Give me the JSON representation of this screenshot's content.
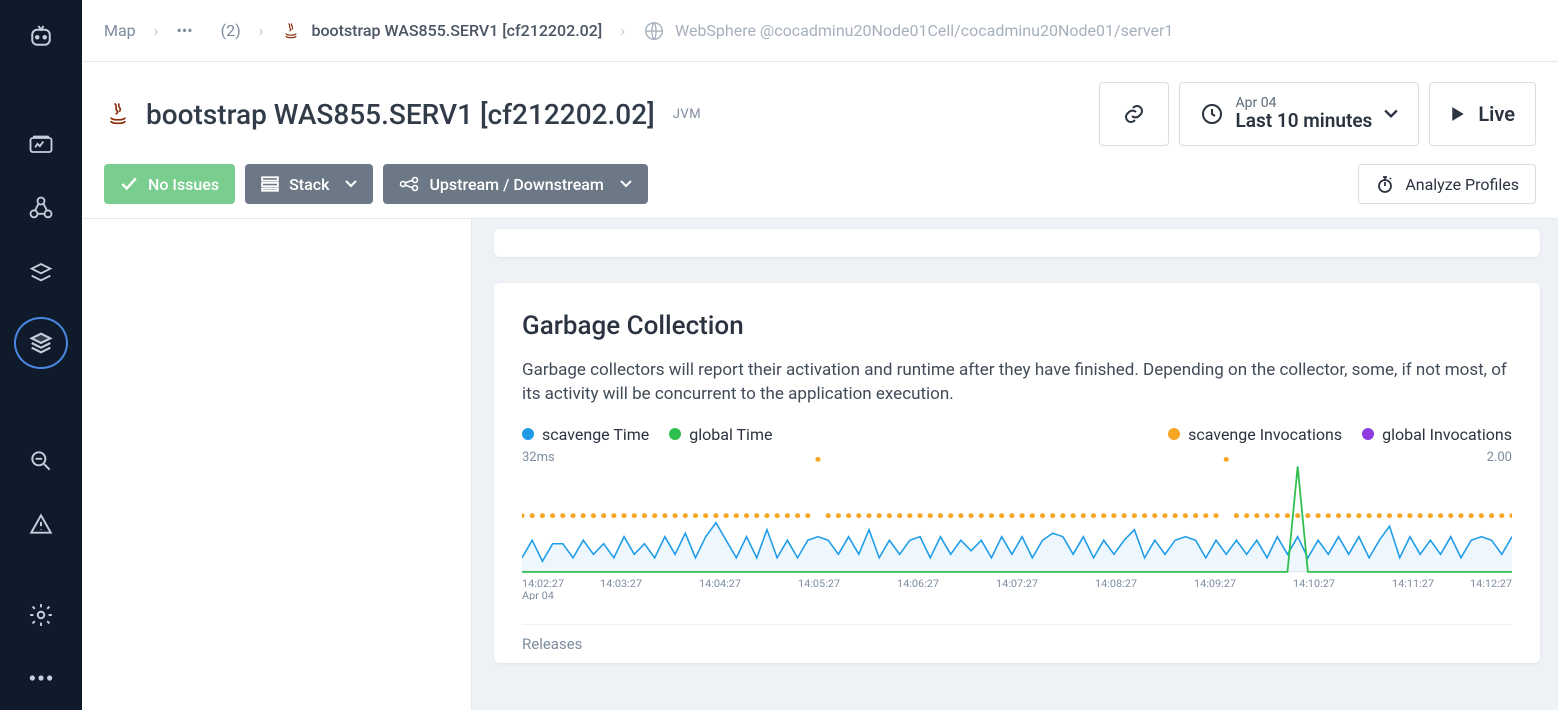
{
  "breadcrumb": {
    "map": "Map",
    "count_label": "(2)",
    "item": "bootstrap WAS855.SERV1 [cf212202.02]",
    "server": "WebSphere @cocadminu20Node01Cell/cocadminu20Node01/server1"
  },
  "page": {
    "title": "bootstrap WAS855.SERV1 [cf212202.02]",
    "tag": "JVM"
  },
  "timeframe": {
    "date": "Apr 04",
    "range": "Last 10 minutes",
    "live": "Live"
  },
  "status": {
    "no_issues": "No Issues"
  },
  "toolbar": {
    "stack": "Stack",
    "updown": "Upstream / Downstream",
    "analyze": "Analyze Profiles"
  },
  "gc": {
    "title": "Garbage Collection",
    "desc": "Garbage collectors will report their activation and runtime after they have finished. Depending on the collector, some, if not most, of its activity will be concurrent to the application execution.",
    "legend": {
      "l1": "scavenge Time",
      "l2": "global Time",
      "r1": "scavenge Invocations",
      "r2": "global Invocations"
    },
    "y_left": "32ms",
    "y_right": "2.00",
    "releases": "Releases",
    "x_date": "Apr 04"
  },
  "colors": {
    "blue": "#1f9ce8",
    "green": "#2fbf4e",
    "orange": "#f5a623",
    "purple": "#8e3ce0"
  },
  "chart_data": {
    "type": "line",
    "title": "Garbage Collection",
    "xlabel": "Apr 04",
    "y_left_lim": [
      0,
      32
    ],
    "y_right_lim": [
      0,
      2
    ],
    "x_ticks": [
      "14:02:27",
      "14:03:27",
      "14:04:27",
      "14:05:27",
      "14:06:27",
      "14:07:27",
      "14:08:27",
      "14:09:27",
      "14:10:27",
      "14:11:27",
      "14:12:27"
    ],
    "series": [
      {
        "name": "scavenge Time",
        "axis": "left",
        "color": "#1f9ce8",
        "values_ms": [
          4,
          9,
          3,
          8,
          8,
          4,
          9,
          5,
          8,
          4,
          10,
          5,
          8,
          4,
          10,
          5,
          11,
          4,
          10,
          14,
          9,
          4,
          10,
          4,
          12,
          4,
          9,
          4,
          9,
          10,
          9,
          5,
          10,
          5,
          12,
          4,
          9,
          5,
          9,
          10,
          4,
          10,
          5,
          9,
          6,
          9,
          4,
          10,
          5,
          10,
          4,
          9,
          11,
          10,
          5,
          10,
          4,
          9,
          5,
          9,
          12,
          4,
          9,
          5,
          9,
          10,
          9,
          4,
          9,
          5,
          9,
          5,
          9,
          4,
          10,
          5,
          10,
          4,
          9,
          5,
          10,
          5,
          10,
          4,
          9,
          13,
          4,
          10,
          5,
          9,
          5,
          10,
          4,
          9,
          10,
          9,
          5,
          10
        ]
      },
      {
        "name": "global Time",
        "axis": "left",
        "color": "#2fbf4e",
        "values_ms": [
          0,
          0,
          0,
          0,
          0,
          0,
          0,
          0,
          0,
          0,
          0,
          0,
          0,
          0,
          0,
          0,
          0,
          0,
          0,
          0,
          0,
          0,
          0,
          0,
          0,
          0,
          0,
          0,
          0,
          0,
          0,
          0,
          0,
          0,
          0,
          0,
          0,
          0,
          0,
          0,
          0,
          0,
          0,
          0,
          0,
          0,
          0,
          0,
          0,
          0,
          0,
          0,
          0,
          0,
          0,
          0,
          0,
          0,
          0,
          0,
          0,
          0,
          0,
          0,
          0,
          0,
          0,
          0,
          0,
          0,
          0,
          0,
          0,
          0,
          0,
          0,
          30,
          0,
          0,
          0,
          0,
          0,
          0,
          0,
          0,
          0,
          0,
          0,
          0,
          0,
          0,
          0,
          0,
          0,
          0,
          0,
          0,
          0
        ]
      },
      {
        "name": "scavenge Invocations",
        "axis": "right",
        "color": "#f5a623",
        "values": [
          1,
          1,
          1,
          1,
          1,
          1,
          1,
          1,
          1,
          1,
          1,
          1,
          1,
          1,
          1,
          1,
          1,
          1,
          1,
          1,
          1,
          1,
          1,
          1,
          1,
          1,
          1,
          1,
          1,
          2,
          1,
          1,
          1,
          1,
          1,
          1,
          1,
          1,
          1,
          1,
          1,
          1,
          1,
          1,
          1,
          1,
          1,
          1,
          1,
          1,
          1,
          1,
          1,
          1,
          1,
          1,
          1,
          1,
          1,
          1,
          1,
          1,
          1,
          1,
          1,
          1,
          1,
          1,
          1,
          2,
          1,
          1,
          1,
          1,
          1,
          1,
          1,
          1,
          1,
          1,
          1,
          1,
          1,
          1,
          1,
          1,
          1,
          1,
          1,
          1,
          1,
          1,
          1,
          1,
          1,
          1,
          1,
          1
        ]
      },
      {
        "name": "global Invocations",
        "axis": "right",
        "color": "#8e3ce0",
        "values": []
      }
    ]
  }
}
